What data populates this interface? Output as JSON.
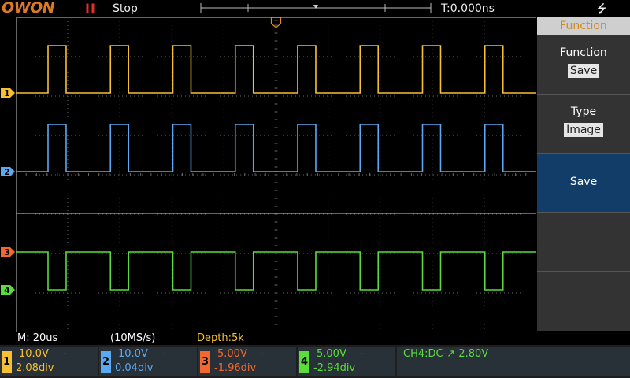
{
  "header": {
    "brand": "OWON",
    "run_icon": "II",
    "run_state": "Stop",
    "time_offset": "T:0.000ns",
    "usb_icon": "usb-icon"
  },
  "colors": {
    "ch1": "#f7c033",
    "ch2": "#5aa9f2",
    "ch3": "#f2682f",
    "ch4": "#5bdc3c",
    "grid": "#666666",
    "trigger": "#e08a25"
  },
  "menu": {
    "title": "Function",
    "items": [
      {
        "label": "Function",
        "value": "Save"
      },
      {
        "label": "Type",
        "value": "Image"
      },
      {
        "label": "Save",
        "value": ""
      },
      {
        "label": "",
        "value": ""
      },
      {
        "label": "",
        "value": ""
      }
    ]
  },
  "status": {
    "timebase": "M: 20us",
    "sample_rate": "(10MS/s)",
    "depth": "Depth:5k"
  },
  "channels": [
    {
      "num": "1",
      "volts": "10.0V",
      "coupling": "-",
      "offset": "2.08div"
    },
    {
      "num": "2",
      "volts": "10.0V",
      "coupling": "-",
      "offset": "0.04div"
    },
    {
      "num": "3",
      "volts": "5.00V",
      "coupling": "-",
      "offset": "-1.96div"
    },
    {
      "num": "4",
      "volts": "5.00V",
      "coupling": "-",
      "offset": "-2.94div"
    }
  ],
  "trigger": {
    "text": "CH4:DC-↗ 2.80V",
    "marker": "T"
  },
  "markers": [
    "1",
    "2",
    "3",
    "4"
  ]
}
